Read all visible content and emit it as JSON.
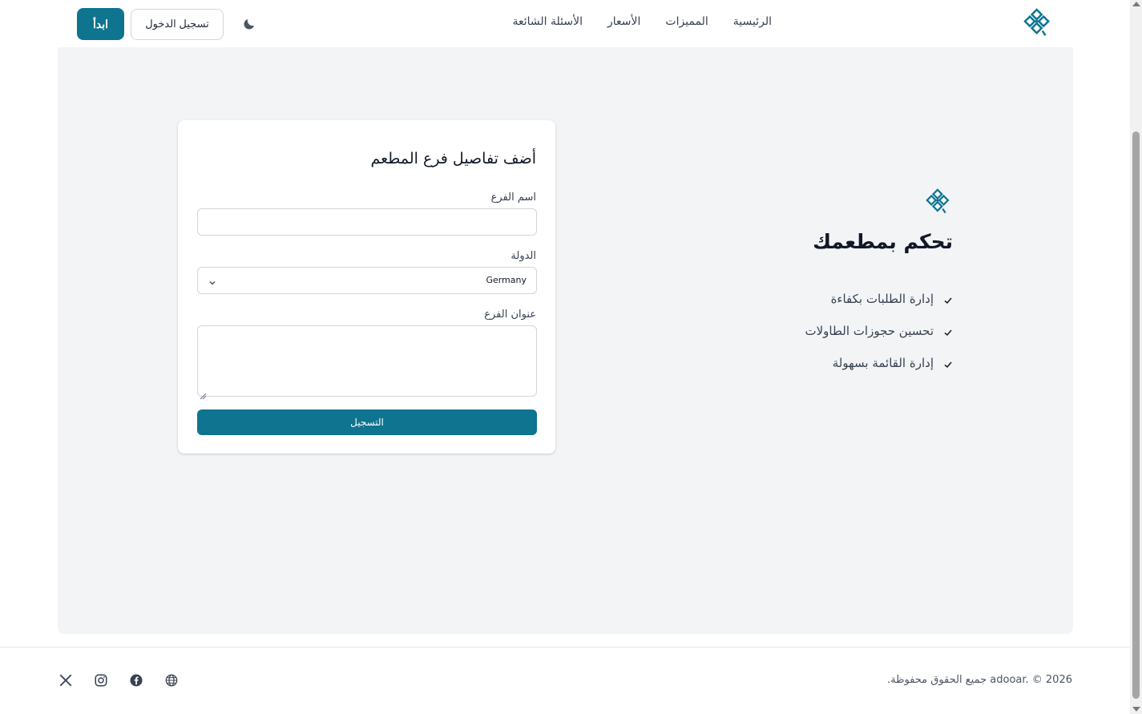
{
  "colors": {
    "primary": "#0e7490",
    "background": "#f3f4f6",
    "card": "#ffffff",
    "text": "#1f2937"
  },
  "header": {
    "logo_icon": "brand-logo-icon",
    "nav": [
      {
        "label": "الرئيسية"
      },
      {
        "label": "المميزات"
      },
      {
        "label": "الأسعار"
      },
      {
        "label": "الأسئلة الشائعة"
      }
    ],
    "theme_toggle_icon": "moon-icon",
    "login_label": "تسجيل الدخول",
    "start_label": "ابدأ"
  },
  "form": {
    "title": "أضف تفاصيل فرع المطعم",
    "branch_name_label": "اسم الفرع",
    "branch_name_value": "",
    "country_label": "الدولة",
    "country_value": "Germany",
    "address_label": "عنوان الفرع",
    "address_value": "",
    "submit_label": "التسجيل"
  },
  "promo": {
    "logo_icon": "brand-logo-icon",
    "title": "تحكم بمطعمك",
    "features": [
      {
        "label": "إدارة الطلبات بكفاءة"
      },
      {
        "label": "تحسين حجوزات الطاولات"
      },
      {
        "label": "إدارة القائمة بسهولة"
      }
    ]
  },
  "footer": {
    "copyright": "adooar. © 2026 جميع الحقوق محفوظة.",
    "socials": [
      "x-icon",
      "instagram-icon",
      "facebook-icon"
    ],
    "language_icon": "globe-icon"
  }
}
